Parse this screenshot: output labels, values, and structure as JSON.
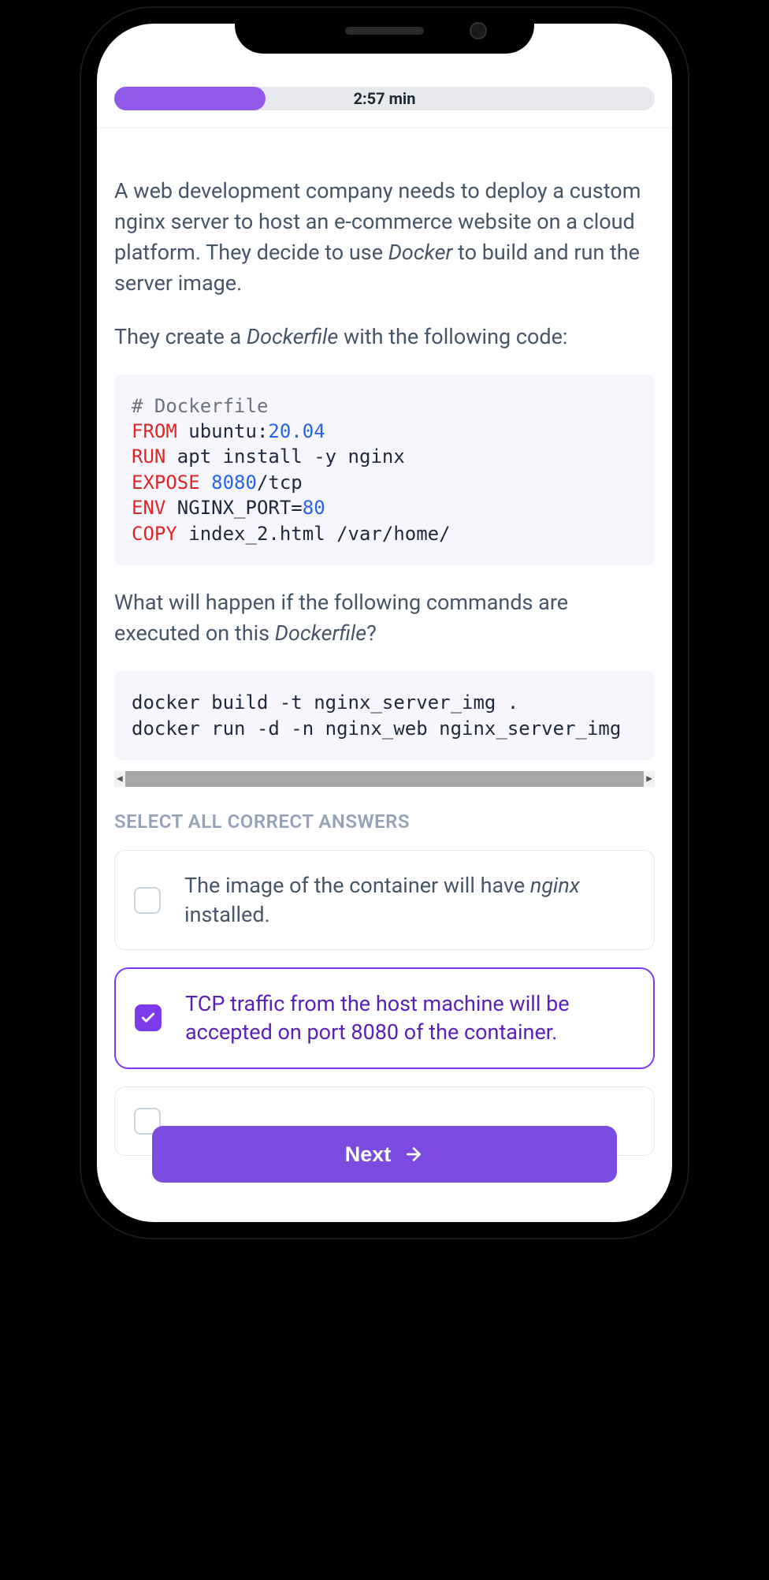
{
  "progress": {
    "percent": 28,
    "timer": "2:57 min"
  },
  "question": {
    "intro_part1": "A web development company needs to deploy a custom nginx server to host an e-commerce website on a cloud platform. They decide to use ",
    "intro_docker": "Docker",
    "intro_part2": " to build and run the server image.",
    "dockerfile_prompt_part1": "They create a ",
    "dockerfile_prompt_em": "Dockerfile",
    "dockerfile_prompt_part2": " with the following code:",
    "code_dockerfile": {
      "comment": "# Dockerfile",
      "from_kw": "FROM",
      "from_rest_1": " ubuntu:",
      "from_num": "20.04",
      "run_kw": "RUN",
      "run_rest": " apt install -y nginx",
      "expose_kw": "EXPOSE",
      "expose_sp": " ",
      "expose_num": "8080",
      "expose_rest": "/tcp",
      "env_kw": "ENV",
      "env_rest_1": " NGINX_PORT=",
      "env_num": "80",
      "copy_kw": "COPY",
      "copy_rest": " index_2.html /var/home/"
    },
    "followup_part1": "What will happen if the following commands are executed on this ",
    "followup_em": "Dockerfile",
    "followup_part2": "?",
    "code_commands": "docker build -t nginx_server_img .\ndocker run -d -n nginx_web nginx_server_img"
  },
  "answers": {
    "label": "SELECT ALL CORRECT ANSWERS",
    "options": [
      {
        "text_pre": "The image of the container will have ",
        "text_em": "nginx",
        "text_post": " installed.",
        "selected": false
      },
      {
        "text_pre": "TCP traffic from the host machine will be accepted on port 8080 of the container.",
        "text_em": "",
        "text_post": "",
        "selected": true
      }
    ]
  },
  "nextButton": "Next"
}
